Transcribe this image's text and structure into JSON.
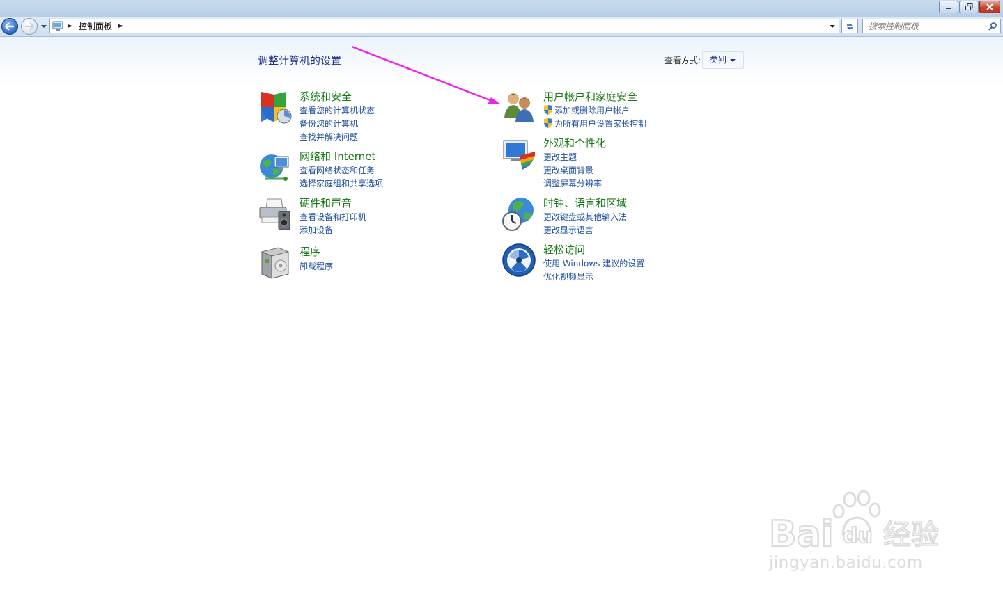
{
  "address_bar": {
    "breadcrumb": "控制面板",
    "search_placeholder": "搜索控制面板"
  },
  "page": {
    "title": "调整计算机的设置",
    "view_by_label": "查看方式:",
    "view_by_value": "类别"
  },
  "categories": [
    {
      "title": "系统和安全",
      "icon": "shield-icon",
      "links": [
        "查看您的计算机状态",
        "备份您的计算机",
        "查找并解决问题"
      ]
    },
    {
      "title": "网络和 Internet",
      "icon": "network-globe-icon",
      "links": [
        "查看网络状态和任务",
        "选择家庭组和共享选项"
      ]
    },
    {
      "title": "硬件和声音",
      "icon": "printer-speaker-icon",
      "links": [
        "查看设备和打印机",
        "添加设备"
      ]
    },
    {
      "title": "程序",
      "icon": "programs-box-icon",
      "links": [
        "卸载程序"
      ]
    },
    {
      "title": "用户帐户和家庭安全",
      "icon": "users-icon",
      "links": [
        "添加或删除用户帐户",
        "为所有用户设置家长控制"
      ]
    },
    {
      "title": "外观和个性化",
      "icon": "monitor-palette-icon",
      "links": [
        "更改主题",
        "更改桌面背景",
        "调整屏幕分辨率"
      ]
    },
    {
      "title": "时钟、语言和区域",
      "icon": "clock-globe-icon",
      "links": [
        "更改键盘或其他输入法",
        "更改显示语言"
      ]
    },
    {
      "title": "轻松访问",
      "icon": "ease-of-access-icon",
      "links": [
        "使用 Windows 建议的设置",
        "优化视频显示"
      ]
    }
  ],
  "watermark": {
    "logo_text": "Baidu经验",
    "url_text": "jingyan.baidu.com"
  },
  "colors": {
    "category_title": "#1a7a1a",
    "link": "#1f4f9f",
    "annotation_arrow": "#ee22ee"
  }
}
